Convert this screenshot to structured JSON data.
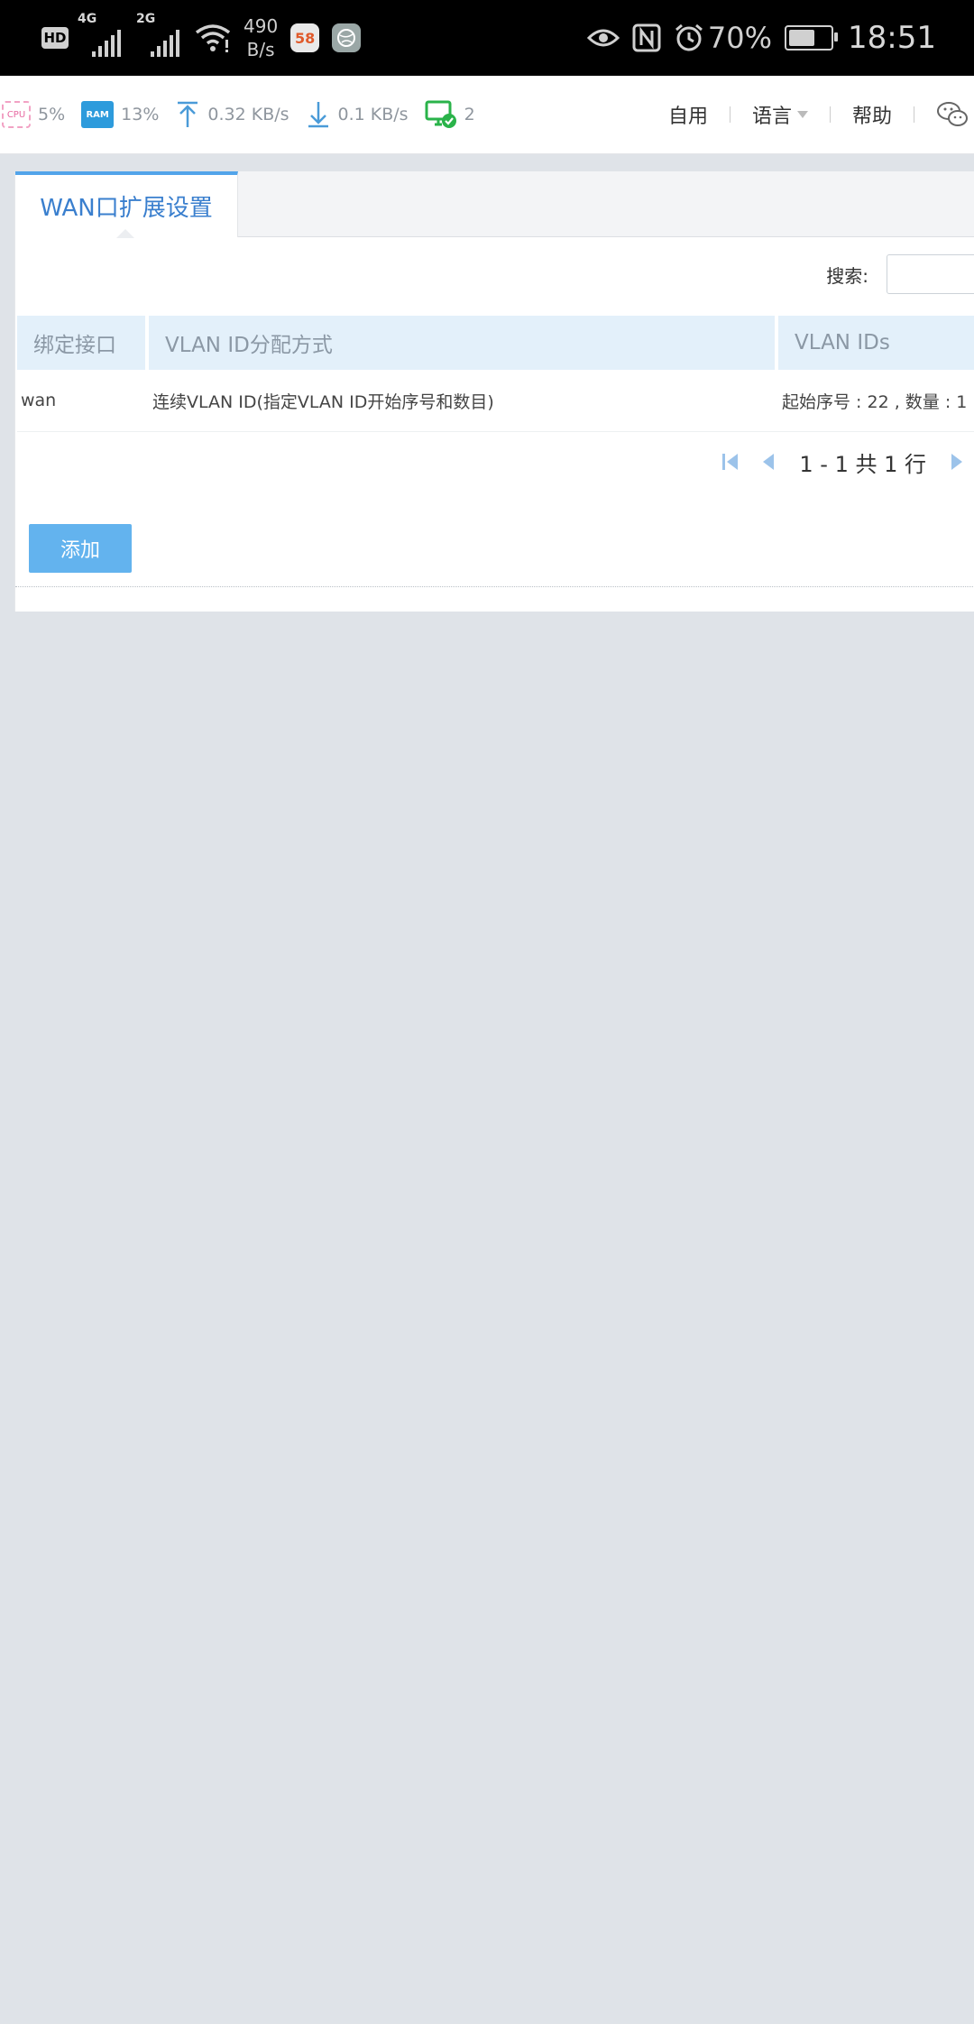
{
  "statusbar": {
    "hd": "HD",
    "sim1_gen": "4G",
    "sim2_gen": "2G",
    "net_speed_value": "490",
    "net_speed_unit": "B/s",
    "app1": "58",
    "battery_percent": "70%",
    "battery_level": 0.7,
    "time": "18:51",
    "icons": [
      "eye-icon",
      "nfc-icon",
      "alarm-icon",
      "battery-icon"
    ]
  },
  "toolbar": {
    "cpu_label": "CPU",
    "cpu_value": "5%",
    "ram_label": "RAM",
    "ram_value": "13%",
    "upload": "0.32 KB/s",
    "download": "0.1 KB/s",
    "devices": "2",
    "menu": {
      "self_use": "自用",
      "language": "语言",
      "help": "帮助"
    }
  },
  "panel": {
    "tab_title": "WAN口扩展设置",
    "search_label": "搜索:",
    "search_value": "",
    "table": {
      "headers": [
        "绑定接口",
        "VLAN ID分配方式",
        "VLAN IDs"
      ],
      "rows": [
        [
          "wan",
          "连续VLAN ID(指定VLAN ID开始序号和数目)",
          "起始序号 : 22 , 数量 : 1"
        ]
      ]
    },
    "pagination": "1 - 1 共 1 行",
    "add_button": "添加"
  },
  "colors": {
    "accent": "#52a4ea",
    "button": "#63b3ee",
    "header_bg": "#e3f0fa",
    "page_bg": "#dfe3e8"
  }
}
